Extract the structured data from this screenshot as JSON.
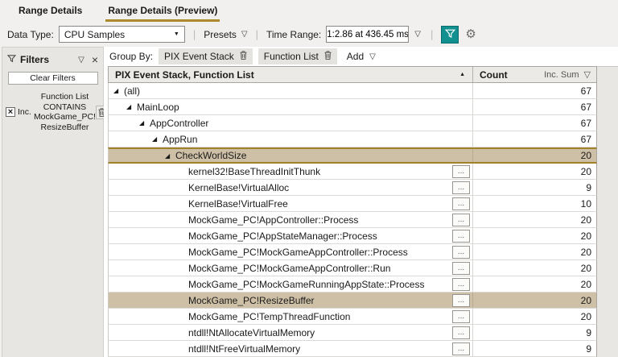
{
  "tabs": [
    {
      "label": "Range Details",
      "active": false
    },
    {
      "label": "Range Details (Preview)",
      "active": true
    }
  ],
  "toolbar": {
    "data_type_label": "Data Type:",
    "data_type_value": "CPU Samples",
    "presets_label": "Presets",
    "time_range_label": "Time Range:",
    "time_range_value": "1:2.86 at 436.45 ms"
  },
  "filters": {
    "title": "Filters",
    "clear_button": "Clear Filters",
    "item": {
      "checked": true,
      "mode": "Inc.",
      "lines": [
        "Function List",
        "CONTAINS",
        "MockGame_PC!",
        "ResizeBuffer"
      ]
    }
  },
  "group_by": {
    "label": "Group By:",
    "chips": [
      "PIX Event Stack",
      "Function List"
    ],
    "add_label": "Add"
  },
  "table": {
    "column1_header": "PIX Event Stack, Function List",
    "column2_header": "Count",
    "column2_aggregation": "Inc. Sum",
    "rows": [
      {
        "label": "(all)",
        "level": 0,
        "expanded": true,
        "leaf": false,
        "count": 67,
        "state": ""
      },
      {
        "label": "MainLoop",
        "level": 1,
        "expanded": true,
        "leaf": false,
        "count": 67,
        "state": ""
      },
      {
        "label": "AppController",
        "level": 2,
        "expanded": true,
        "leaf": false,
        "count": 67,
        "state": ""
      },
      {
        "label": "AppRun",
        "level": 3,
        "expanded": true,
        "leaf": false,
        "count": 67,
        "state": ""
      },
      {
        "label": "CheckWorldSize",
        "level": 4,
        "expanded": true,
        "leaf": false,
        "count": 20,
        "state": "selected"
      },
      {
        "label": "kernel32!BaseThreadInitThunk",
        "level": 5,
        "expanded": false,
        "leaf": true,
        "count": 20,
        "state": ""
      },
      {
        "label": "KernelBase!VirtualAlloc",
        "level": 5,
        "expanded": false,
        "leaf": true,
        "count": 9,
        "state": ""
      },
      {
        "label": "KernelBase!VirtualFree",
        "level": 5,
        "expanded": false,
        "leaf": true,
        "count": 10,
        "state": ""
      },
      {
        "label": "MockGame_PC!AppController::Process",
        "level": 5,
        "expanded": false,
        "leaf": true,
        "count": 20,
        "state": ""
      },
      {
        "label": "MockGame_PC!AppStateManager::Process",
        "level": 5,
        "expanded": false,
        "leaf": true,
        "count": 20,
        "state": ""
      },
      {
        "label": "MockGame_PC!MockGameAppController::Process",
        "level": 5,
        "expanded": false,
        "leaf": true,
        "count": 20,
        "state": ""
      },
      {
        "label": "MockGame_PC!MockGameAppController::Run",
        "level": 5,
        "expanded": false,
        "leaf": true,
        "count": 20,
        "state": ""
      },
      {
        "label": "MockGame_PC!MockGameRunningAppState::Process",
        "level": 5,
        "expanded": false,
        "leaf": true,
        "count": 20,
        "state": ""
      },
      {
        "label": "MockGame_PC!ResizeBuffer",
        "level": 5,
        "expanded": false,
        "leaf": true,
        "count": 20,
        "state": "match"
      },
      {
        "label": "MockGame_PC!TempThreadFunction",
        "level": 5,
        "expanded": false,
        "leaf": true,
        "count": 20,
        "state": ""
      },
      {
        "label": "ntdll!NtAllocateVirtualMemory",
        "level": 5,
        "expanded": false,
        "leaf": true,
        "count": 9,
        "state": ""
      },
      {
        "label": "ntdll!NtFreeVirtualMemory",
        "level": 5,
        "expanded": false,
        "leaf": true,
        "count": 9,
        "state": ""
      }
    ]
  },
  "icons": {
    "expander": "◢",
    "sort_asc": "▲",
    "dropdown": "▽",
    "combo_caret": "▼",
    "gear": "⚙",
    "close": "×",
    "checkbox_mark": "×",
    "details": "..."
  },
  "colors": {
    "accent_gold": "#ab8a2b",
    "selected_border_gold": "#a0822a",
    "highlight_tan": "#cec0a7",
    "teal": "#129090"
  }
}
